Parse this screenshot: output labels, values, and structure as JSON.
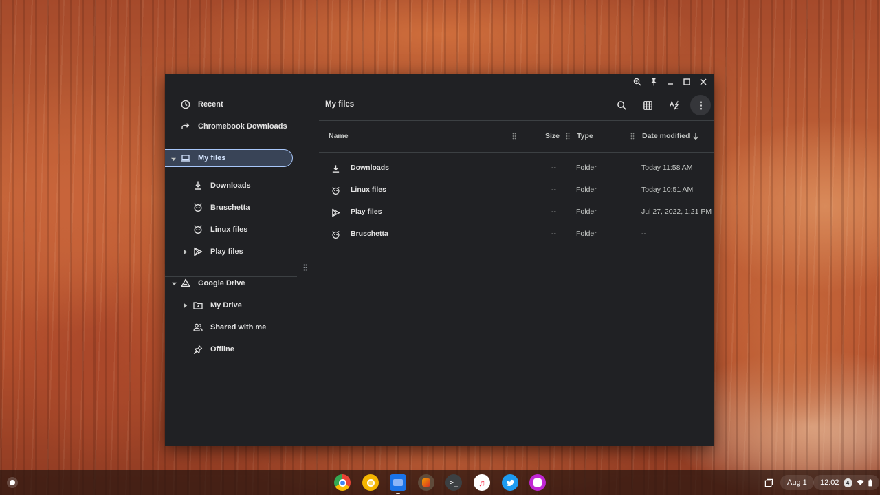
{
  "window": {
    "controls": [
      "zoom-icon",
      "pin-icon",
      "minimize-icon",
      "maximize-icon",
      "close-icon"
    ]
  },
  "sidebar": {
    "recent": "Recent",
    "chromebook_downloads": "Chromebook Downloads",
    "my_files": "My files",
    "my_files_children": {
      "downloads": "Downloads",
      "bruschetta": "Bruschetta",
      "linux_files": "Linux files",
      "play_files": "Play files"
    },
    "google_drive": "Google Drive",
    "drive_children": {
      "my_drive": "My Drive",
      "shared_with_me": "Shared with me",
      "offline": "Offline"
    }
  },
  "main": {
    "title": "My files",
    "toolbar": {
      "search": "search-icon",
      "grid": "grid-view-icon",
      "sort": "sort-az-icon",
      "more": "more-vert-icon"
    },
    "columns": {
      "name": "Name",
      "size": "Size",
      "type": "Type",
      "date": "Date modified"
    },
    "rows": [
      {
        "name": "Downloads",
        "size": "--",
        "type": "Folder",
        "date": "Today 11:58 AM"
      },
      {
        "name": "Linux files",
        "size": "--",
        "type": "Folder",
        "date": "Today 10:51 AM"
      },
      {
        "name": "Play files",
        "size": "--",
        "type": "Folder",
        "date": "Jul 27, 2022, 1:21 PM"
      },
      {
        "name": "Bruschetta",
        "size": "--",
        "type": "Folder",
        "date": "--"
      }
    ]
  },
  "shelf": {
    "apps": [
      "chrome-icon",
      "canary-icon",
      "files-icon",
      "app-icon",
      "terminal-icon",
      "music-icon",
      "twitter-icon",
      "app-purple-icon"
    ],
    "date": "Aug 1",
    "time": "12:02",
    "notification_count": "4"
  },
  "colors": {
    "window_bg": "#202124",
    "selection_bg": "#394457",
    "selection_border": "#a8c7fa"
  }
}
